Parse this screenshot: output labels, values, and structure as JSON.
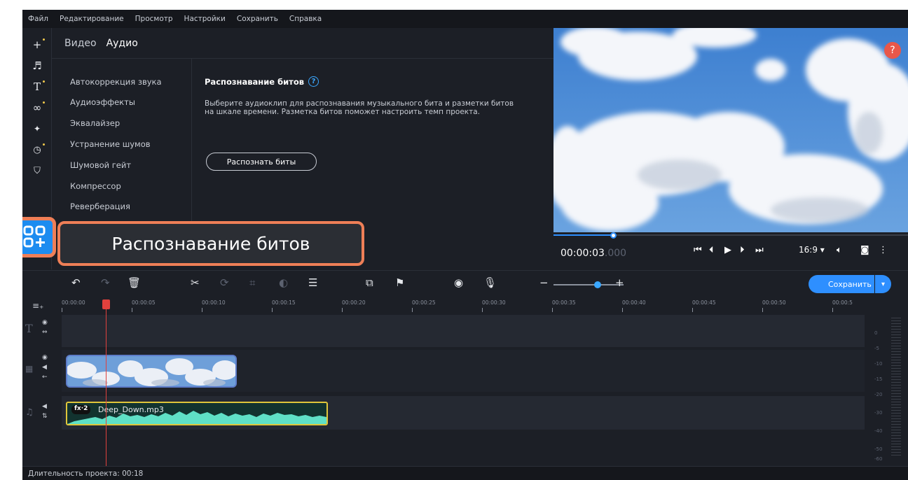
{
  "menu": [
    "Файл",
    "Редактирование",
    "Просмотр",
    "Настройки",
    "Сохранить",
    "Справка"
  ],
  "panel": {
    "tabs": [
      "Видео",
      "Аудио"
    ],
    "active_tab": "Аудио",
    "items": [
      "Автокоррекция звука",
      "Аудиоэффекты",
      "Эквалайзер",
      "Устранение шумов",
      "Шумовой гейт",
      "Компрессор",
      "Реверберация"
    ],
    "title": "Распознавание битов",
    "help": "?",
    "description": "Выберите аудиоклип для распознавания музыкального бита и разметки битов на шкале времени. Разметка битов поможет настроить темп проекта.",
    "button": "Распознать биты"
  },
  "callout": "Распознавание битов",
  "player": {
    "timecode_main": "00:00:03",
    "timecode_ms": ".000",
    "aspect": "16:9",
    "help": "?",
    "progress": 0.17
  },
  "toolbar": {
    "save": "Сохранить"
  },
  "ruler": [
    "00:00:00",
    "00:00:05",
    "00:00:10",
    "00:00:15",
    "00:00:20",
    "00:00:25",
    "00:00:30",
    "00:00:35",
    "00:00:40",
    "00:00:45",
    "00:00:50",
    "00:00:5"
  ],
  "audio_clip": {
    "fx": "fx·2",
    "name": "Deep_Down.mp3"
  },
  "meter": [
    "0",
    "-5",
    "-10",
    "-15",
    "-20",
    "-30",
    "-40",
    "-50",
    "-60"
  ],
  "status": "Длительность проекта: 00:18",
  "colors": {
    "accent": "#2e8fff",
    "highlight": "#ef7f57",
    "playhead": "#e0413d",
    "audio_border": "#e0c63a"
  }
}
